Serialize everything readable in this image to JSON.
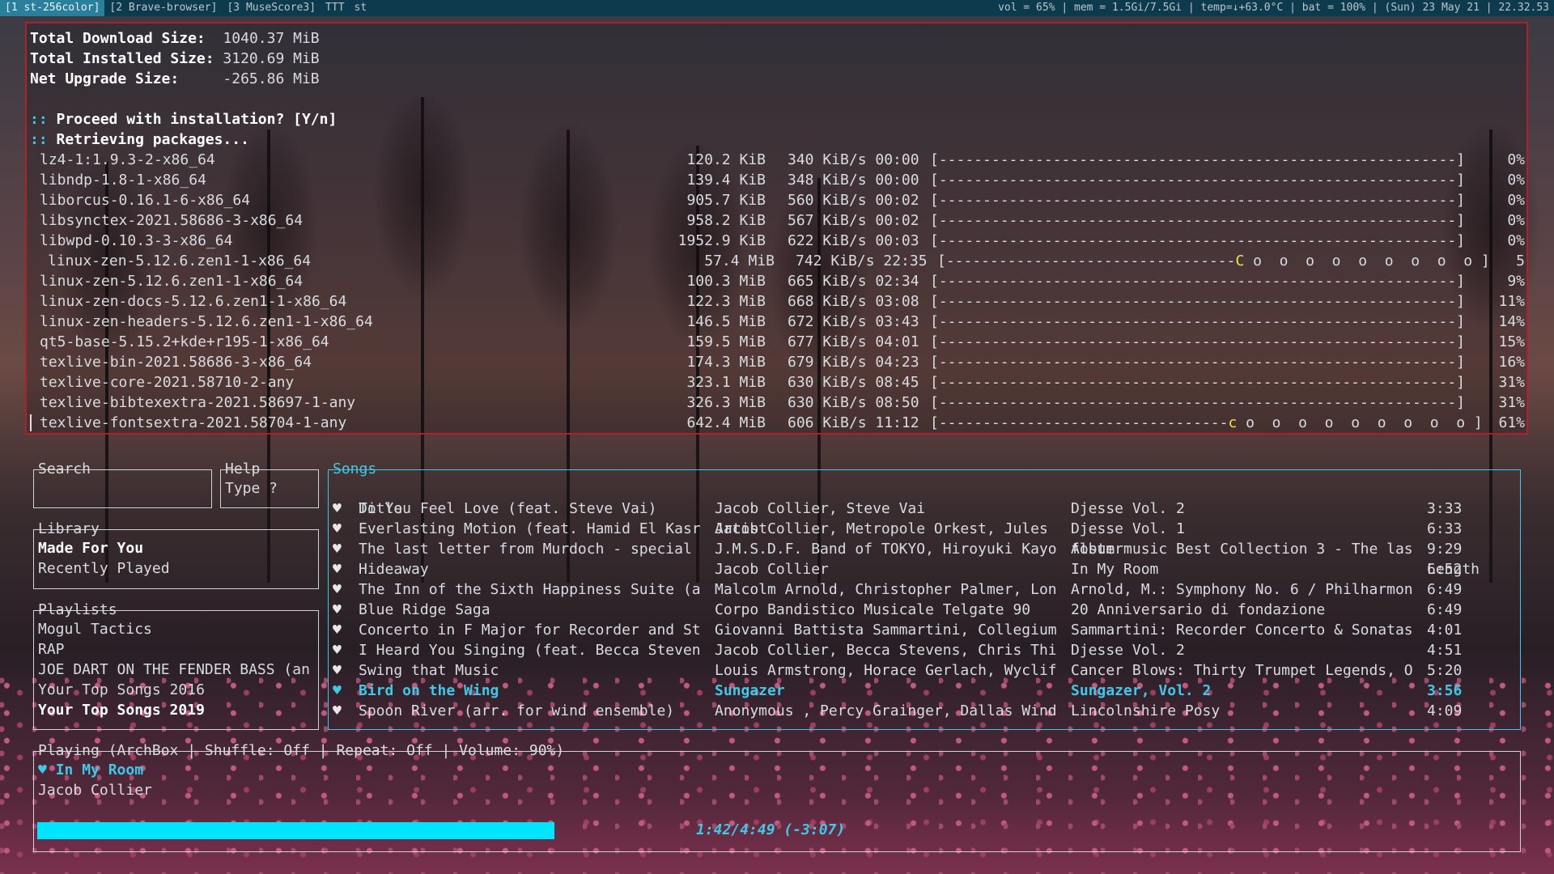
{
  "topbar": {
    "tags": [
      "[1 st-256color]",
      "[2 Brave-browser]",
      "[3 MuseScore3]",
      "TTT",
      "st"
    ],
    "status": "vol = 65% | mem = 1.5Gi/7.5Gi | temp=↓+63.0°C | bat = 100% | (Sun) 23 May 21 | 22.32.53"
  },
  "terminal": {
    "download_label": "Total Download Size:",
    "download_value": "1040.37 MiB",
    "installed_label": "Total Installed Size:",
    "installed_value": "3120.69 MiB",
    "upgrade_label": "Net Upgrade Size:",
    "upgrade_value": "-265.86 MiB",
    "prompt_prefix": "::",
    "proceed": "Proceed with installation? [Y/n]",
    "retrieving": "Retrieving packages...",
    "packages": [
      {
        "name": "lz4-1:1.9.3-2-x86_64",
        "size": "120.2 KiB",
        "rate": "340 KiB/s 00:00",
        "bar": "[-----------------------------------------------------------]",
        "pct": "0%"
      },
      {
        "name": "libndp-1.8-1-x86_64",
        "size": "139.4 KiB",
        "rate": "348 KiB/s 00:00",
        "bar": "[-----------------------------------------------------------]",
        "pct": "0%"
      },
      {
        "name": "liborcus-0.16.1-6-x86_64",
        "size": "905.7 KiB",
        "rate": "560 KiB/s 00:02",
        "bar": "[-----------------------------------------------------------]",
        "pct": "0%"
      },
      {
        "name": "libsynctex-2021.58686-3-x86_64",
        "size": "958.2 KiB",
        "rate": "567 KiB/s 00:02",
        "bar": "[-----------------------------------------------------------]",
        "pct": "0%"
      },
      {
        "name": "libwpd-0.10.3-3-x86_64",
        "size": "1952.9 KiB",
        "rate": "622 KiB/s 00:03",
        "bar": "[-----------------------------------------------------------]",
        "pct": "0%"
      },
      {
        "name": "linux-zen-5.12.6.zen1-1-x86_64",
        "size": "57.4 MiB",
        "rate": "742 KiB/s 22:35",
        "bar_pre": "[---------------------------------",
        "pac": "C",
        "bar_post": " o  o  o  o  o  o  o  o  o ]",
        "pct": "5",
        "special": true
      },
      {
        "name": "linux-zen-5.12.6.zen1-1-x86_64",
        "size": "100.3 MiB",
        "rate": "665 KiB/s 02:34",
        "bar": "[-----------------------------------------------------------]",
        "pct": "9%"
      },
      {
        "name": "linux-zen-docs-5.12.6.zen1-1-x86_64",
        "size": "122.3 MiB",
        "rate": "668 KiB/s 03:08",
        "bar": "[-----------------------------------------------------------]",
        "pct": "11%"
      },
      {
        "name": "linux-zen-headers-5.12.6.zen1-1-x86_64",
        "size": "146.5 MiB",
        "rate": "672 KiB/s 03:43",
        "bar": "[-----------------------------------------------------------]",
        "pct": "14%"
      },
      {
        "name": "qt5-base-5.15.2+kde+r195-1-x86_64",
        "size": "159.5 MiB",
        "rate": "677 KiB/s 04:01",
        "bar": "[-----------------------------------------------------------]",
        "pct": "15%"
      },
      {
        "name": "texlive-bin-2021.58686-3-x86_64",
        "size": "174.3 MiB",
        "rate": "679 KiB/s 04:23",
        "bar": "[-----------------------------------------------------------]",
        "pct": "16%"
      },
      {
        "name": "texlive-core-2021.58710-2-any",
        "size": "323.1 MiB",
        "rate": "630 KiB/s 08:45",
        "bar": "[-----------------------------------------------------------]",
        "pct": "31%"
      },
      {
        "name": "texlive-bibtexextra-2021.58697-1-any",
        "size": "326.3 MiB",
        "rate": "630 KiB/s 08:50",
        "bar": "[-----------------------------------------------------------]",
        "pct": "31%"
      },
      {
        "name": "texlive-fontsextra-2021.58704-1-any",
        "size": "642.4 MiB",
        "rate": "606 KiB/s 11:12",
        "bar_pre": "[---------------------------------",
        "pac": "c",
        "bar_post": " o  o  o  o  o  o  o  o  o ]",
        "pct": "61%",
        "cursor": true
      }
    ]
  },
  "player": {
    "search_title": "Search",
    "help_title": "Help",
    "help_text": "Type ?",
    "library_title": "Library",
    "library_items": [
      {
        "label": "Made For You",
        "bold": true
      },
      {
        "label": "Recently Played",
        "bold": false
      }
    ],
    "playlists_title": "Playlists",
    "playlists": [
      {
        "label": "Mogul Tactics",
        "bold": false
      },
      {
        "label": "RAP",
        "bold": false
      },
      {
        "label": "JOE DART ON THE FENDER BASS (an",
        "bold": false
      },
      {
        "label": "Your Top Songs 2016",
        "bold": false
      },
      {
        "label": "Your Top Songs 2019",
        "bold": true
      }
    ],
    "songs_title": "Songs",
    "columns": {
      "title": "Title",
      "artist": "Artist",
      "album": "Album",
      "length": "Length"
    },
    "songs": [
      {
        "title": "Do You Feel Love (feat. Steve Vai)",
        "artist": "Jacob Collier, Steve Vai",
        "album": "Djesse Vol. 2",
        "length": "3:33",
        "selected": false
      },
      {
        "title": "Everlasting Motion (feat. Hamid El Kasr",
        "artist": "Jacob Collier, Metropole Orkest, Jules",
        "album": "Djesse Vol. 1",
        "length": "6:33",
        "selected": false
      },
      {
        "title": "The last letter from Murdoch - special",
        "artist": "J.M.S.D.F. Band of TOKYO, Hiroyuki Kayo",
        "album": "fostermusic Best Collection 3 - The las",
        "length": "9:29",
        "selected": false
      },
      {
        "title": "Hideaway",
        "artist": "Jacob Collier",
        "album": "In My Room",
        "length": "6:52",
        "selected": false
      },
      {
        "title": "The Inn of the Sixth Happiness Suite (a",
        "artist": "Malcolm Arnold, Christopher Palmer, Lon",
        "album": "Arnold, M.: Symphony No. 6 / Philharmon",
        "length": "6:49",
        "selected": false
      },
      {
        "title": "Blue Ridge Saga",
        "artist": "Corpo Bandistico Musicale Telgate 90",
        "album": "20 Anniversario di fondazione",
        "length": "6:49",
        "selected": false
      },
      {
        "title": "Concerto in F Major for Recorder and St",
        "artist": "Giovanni Battista Sammartini, Collegium",
        "album": "Sammartini: Recorder Concerto & Sonatas",
        "length": "4:01",
        "selected": false
      },
      {
        "title": "I Heard You Singing (feat. Becca Steven",
        "artist": "Jacob Collier, Becca Stevens, Chris Thi",
        "album": "Djesse Vol. 2",
        "length": "4:51",
        "selected": false
      },
      {
        "title": "Swing that Music",
        "artist": "Louis Armstrong, Horace Gerlach, Wyclif",
        "album": "Cancer Blows: Thirty Trumpet Legends, O",
        "length": "5:20",
        "selected": false
      },
      {
        "title": "Bird on the Wing",
        "artist": "Sungazer",
        "album": "Sungazer, Vol. 2",
        "length": "3:56",
        "selected": true
      },
      {
        "title": "Spoon River (arr. for wind ensemble)",
        "artist": "Anonymous , Percy Grainger, Dallas Wind",
        "album": "Lincolnshire Posy",
        "length": "4:09",
        "selected": false
      }
    ],
    "heart_glyph": "♥",
    "playing_title": "Playing (ArchBox | Shuffle: Off | Repeat: Off  | Volume: 90%)",
    "now_playing_track": "In My Room",
    "now_playing_artist": "Jacob Collier",
    "progress_fraction": 0.363,
    "time_text": "1:42/4:49 (-3:07)",
    "accent_color": "#3ec9e8"
  }
}
